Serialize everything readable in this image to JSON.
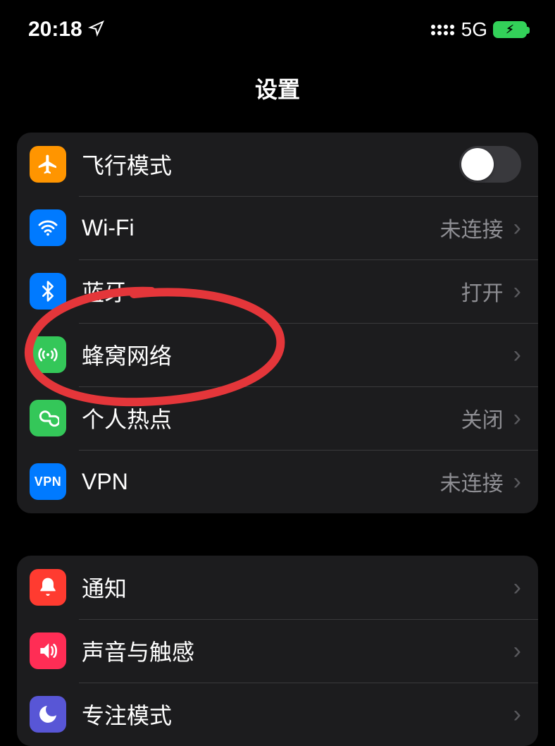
{
  "status": {
    "time": "20:18",
    "network": "5G"
  },
  "header": {
    "title": "设置"
  },
  "group1": {
    "airplane": {
      "label": "飞行模式",
      "on": false
    },
    "wifi": {
      "label": "Wi-Fi",
      "value": "未连接"
    },
    "bluetooth": {
      "label": "蓝牙",
      "value": "打开"
    },
    "cellular": {
      "label": "蜂窝网络"
    },
    "hotspot": {
      "label": "个人热点",
      "value": "关闭"
    },
    "vpn": {
      "label": "VPN",
      "value": "未连接"
    }
  },
  "group2": {
    "notifications": {
      "label": "通知"
    },
    "sounds": {
      "label": "声音与触感"
    },
    "focus": {
      "label": "专注模式"
    }
  }
}
